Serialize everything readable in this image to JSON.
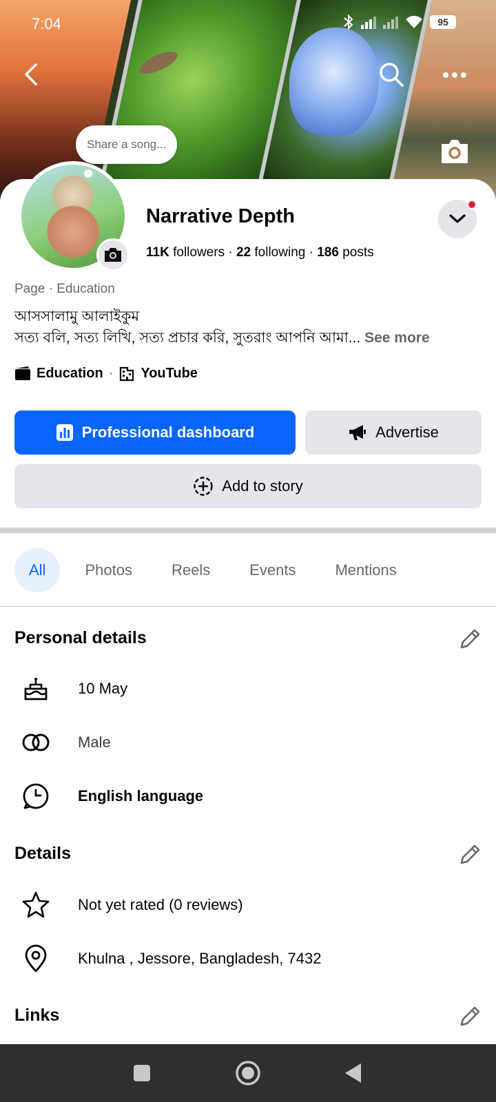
{
  "status_bar": {
    "time": "7:04",
    "battery": "95"
  },
  "bubble": {
    "text": "Share a song..."
  },
  "profile": {
    "name": "Narrative Depth",
    "followers_count": "11K",
    "followers_label": "followers",
    "following_count": "22",
    "following_label": "following",
    "posts_count": "186",
    "posts_label": "posts",
    "separator": "·",
    "category": "Page · Education",
    "bio_line1": "আসসালামু আলাইকুম",
    "bio_line2": "সত্য বলি, সত্য লিখি, সত্য প্রচার করি, সুতরাং আপনি আমা...",
    "see_more": "See more",
    "tag1": "Education",
    "tag_sep": "·",
    "tag2": "YouTube"
  },
  "actions": {
    "dashboard": "Professional dashboard",
    "advertise": "Advertise",
    "add_story": "Add to story"
  },
  "tabs": [
    {
      "label": "All",
      "active": true
    },
    {
      "label": "Photos"
    },
    {
      "label": "Reels"
    },
    {
      "label": "Events"
    },
    {
      "label": "Mentions"
    }
  ],
  "personal_details": {
    "title": "Personal details",
    "birthday": "10 May",
    "gender": "Male",
    "language": "English language"
  },
  "details": {
    "title": "Details",
    "rating": "Not yet rated (0 reviews)",
    "location": "Khulna , Jessore, Bangladesh, 7432"
  },
  "links": {
    "title": "Links"
  },
  "colors": {
    "accent": "#0866ff",
    "secondary_bg": "#e4e6eb",
    "notify": "#e41e3f"
  }
}
